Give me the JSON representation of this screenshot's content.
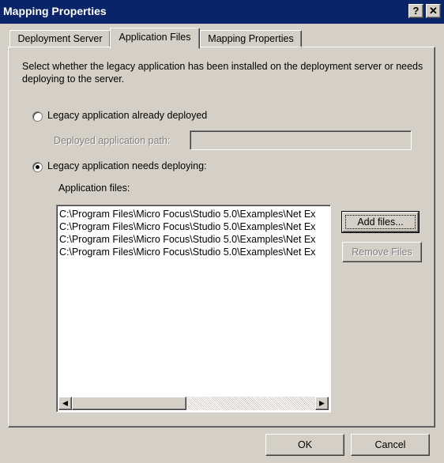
{
  "window": {
    "title": "Mapping Properties",
    "help_label": "?",
    "close_label": "✕"
  },
  "tabs": [
    {
      "label": "Deployment Server"
    },
    {
      "label": "Application Files"
    },
    {
      "label": "Mapping Properties"
    }
  ],
  "active_tab": "Application Files",
  "description": "Select whether the legacy application has been installed on the deployment server or needs deploying to the server.",
  "options": {
    "already_deployed": {
      "label": "Legacy application already deployed",
      "selected": false
    },
    "needs_deploying": {
      "label": "Legacy application needs deploying:",
      "selected": true
    }
  },
  "deployed_path": {
    "label": "Deployed application path:",
    "value": ""
  },
  "app_files": {
    "label": "Application files:",
    "items": [
      "C:\\Program Files\\Micro Focus\\Studio 5.0\\Examples\\Net Ex",
      "C:\\Program Files\\Micro Focus\\Studio 5.0\\Examples\\Net Ex",
      "C:\\Program Files\\Micro Focus\\Studio 5.0\\Examples\\Net Ex",
      "C:\\Program Files\\Micro Focus\\Studio 5.0\\Examples\\Net Ex"
    ]
  },
  "buttons": {
    "add_files": "Add files...",
    "remove_files": "Remove Files",
    "ok": "OK",
    "cancel": "Cancel"
  },
  "scrollbar": {
    "left_arrow": "◀",
    "right_arrow": "▶"
  }
}
